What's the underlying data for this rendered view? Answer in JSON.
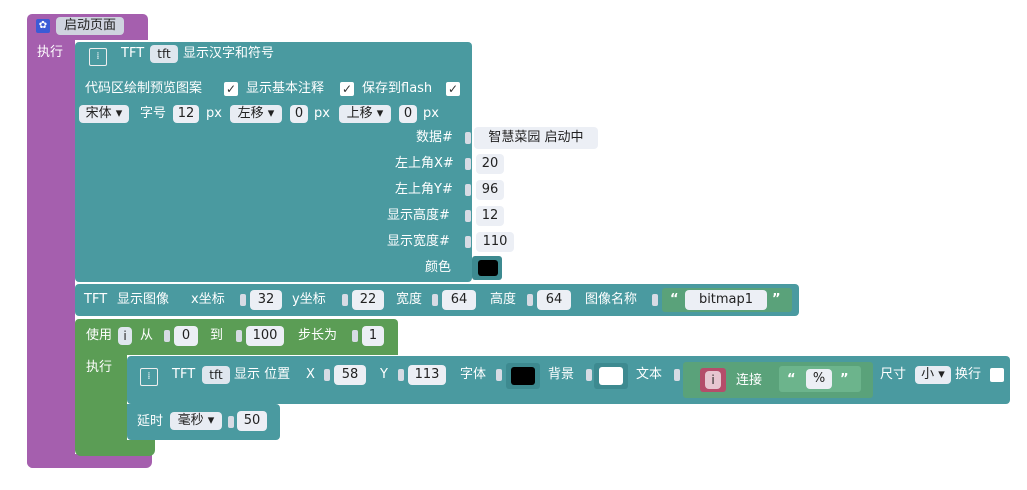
{
  "event_block": {
    "title": "启动页面",
    "do_label": "执行"
  },
  "tft_text_block": {
    "prefix": "TFT",
    "device": "tft",
    "title": "显示汉字和符号",
    "checkbox_draw_preview": "代码区绘制预览图案",
    "checkbox_show_comments": "显示基本注释",
    "checkbox_save_flash": "保存到flash",
    "checkmark": "✓",
    "font_name": "宋体",
    "font_size_label": "字号",
    "font_size": "12",
    "px_unit": "px",
    "shift_x_dir": "左移",
    "shift_x": "0",
    "shift_y_dir": "上移",
    "shift_y": "0",
    "data_label": "数据#",
    "data_value": "智慧菜园 启动中",
    "x_label": "左上角X#",
    "x_value": "20",
    "y_label": "左上角Y#",
    "y_value": "96",
    "height_label": "显示高度#",
    "height_value": "12",
    "width_label": "显示宽度#",
    "width_value": "110",
    "color_label": "颜色",
    "color": "#000000"
  },
  "tft_image_block": {
    "prefix": "TFT",
    "title": "显示图像",
    "x_label": "x坐标",
    "x_value": "32",
    "y_label": "y坐标",
    "y_value": "22",
    "width_label": "宽度",
    "width_value": "64",
    "height_label": "高度",
    "height_value": "64",
    "name_label": "图像名称",
    "quote_open": "“",
    "name_value": "bitmap1",
    "quote_close": "”"
  },
  "for_loop_block": {
    "use_label": "使用",
    "var": "i",
    "from_label": "从",
    "from_value": "0",
    "to_label": "到",
    "to_value": "100",
    "step_label": "步长为",
    "step_value": "1",
    "do_label": "执行"
  },
  "tft_print_block": {
    "prefix": "TFT",
    "device": "tft",
    "title": "显示 位置",
    "x_label": "X",
    "x_value": "58",
    "y_label": "Y",
    "y_value": "113",
    "font_label": "字体",
    "font_color": "#000000",
    "bg_label": "背景",
    "bg_color": "#ffffff",
    "text_label": "文本",
    "join_var": "i",
    "join_label": "连接",
    "quote_open": "“",
    "join_text": "%",
    "quote_close": "”",
    "size_label": "尺寸",
    "size_value": "小",
    "wrap_label": "换行"
  },
  "delay_block": {
    "label": "延时",
    "unit": "毫秒",
    "value": "50"
  }
}
